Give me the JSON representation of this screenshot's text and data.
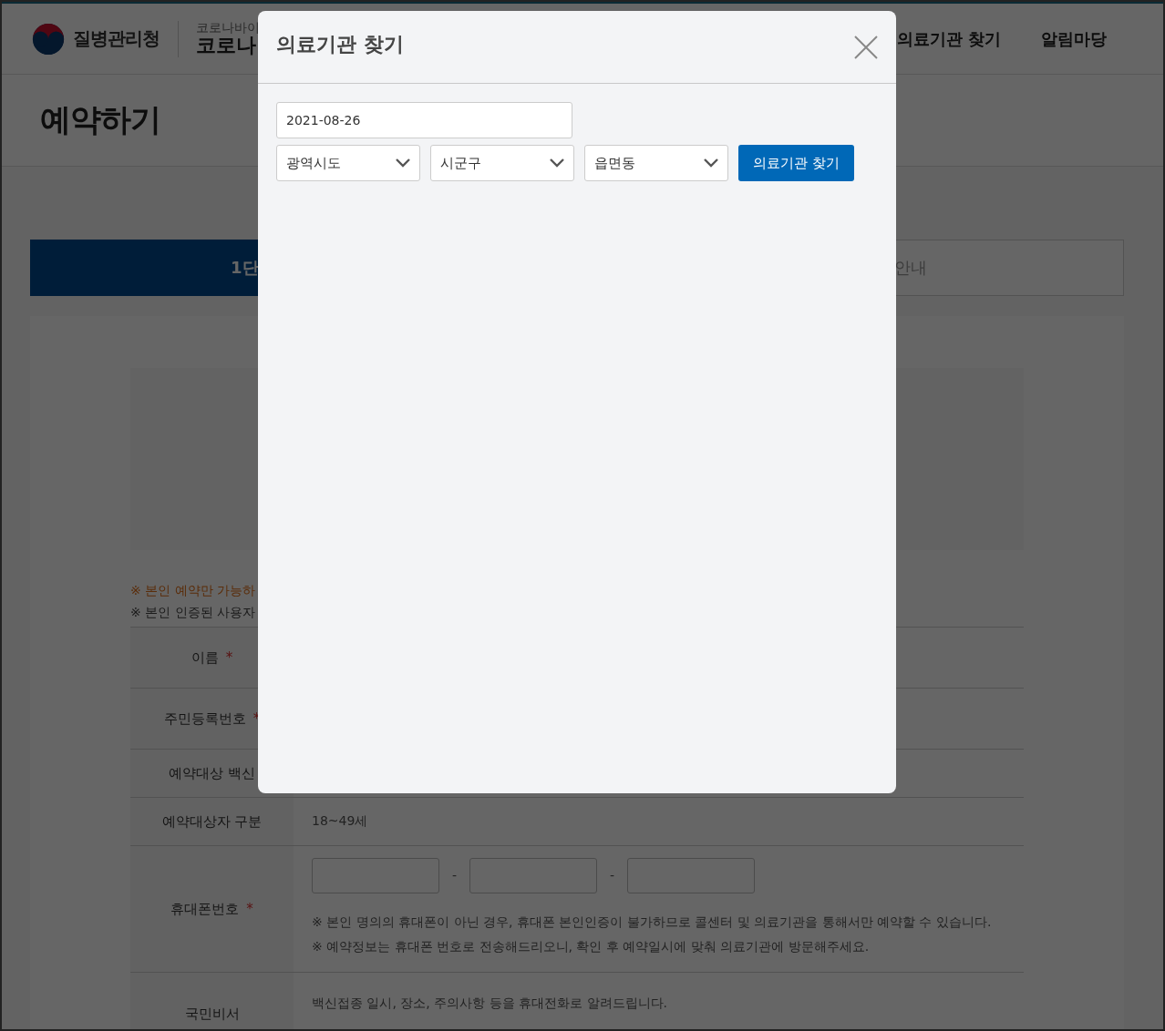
{
  "header": {
    "agency": "질병관리청",
    "site_lines": [
      "코로나바이",
      "코로나"
    ],
    "nav": [
      {
        "label": "의료기관 찾기"
      },
      {
        "label": "알림마당"
      }
    ]
  },
  "page_title": "예약하기",
  "steps": [
    {
      "label": "1단",
      "selected": true
    },
    {
      "label": "안내",
      "selected": false
    }
  ],
  "notes": [
    {
      "text": "※ 본인 예약만 가능하",
      "kind": "warning"
    },
    {
      "text": "※ 본인 인증된 사용자",
      "kind": "info"
    }
  ],
  "form_rows": [
    {
      "label": "이름",
      "marker": "*",
      "kind": "blank"
    },
    {
      "label": "주민등록번호",
      "marker": "*",
      "kind": "blank"
    },
    {
      "label": "예약대상 백신",
      "kind": "blank"
    },
    {
      "label": "예약대상자 구분",
      "kind": "text",
      "value": "18~49세"
    },
    {
      "label": "휴대폰번호",
      "marker": "*",
      "kind": "phone",
      "separators": [
        "-",
        "-"
      ],
      "notes": [
        "※ 본인 명의의 휴대폰이 아닌 경우, 휴대폰 본인인증이 불가하므로 콜센터 및 의료기관을 통해서만 예약할 수 있습니다.",
        "※ 예약정보는 휴대폰 번호로 전송해드리오니, 확인 후 예약일시에 맞춰 의료기관에 방문해주세요."
      ]
    },
    {
      "label": "국민비서",
      "kind": "text",
      "value": "백신접종 일시, 장소, 주의사항 등을 휴대전화로 알려드립니다."
    }
  ],
  "modal": {
    "title": "의료기관 찾기",
    "date": "2021-08-26",
    "selects": [
      {
        "value": "광역시도"
      },
      {
        "value": "시군구"
      },
      {
        "value": "읍면동"
      }
    ],
    "button": "의료기관 찾기"
  }
}
